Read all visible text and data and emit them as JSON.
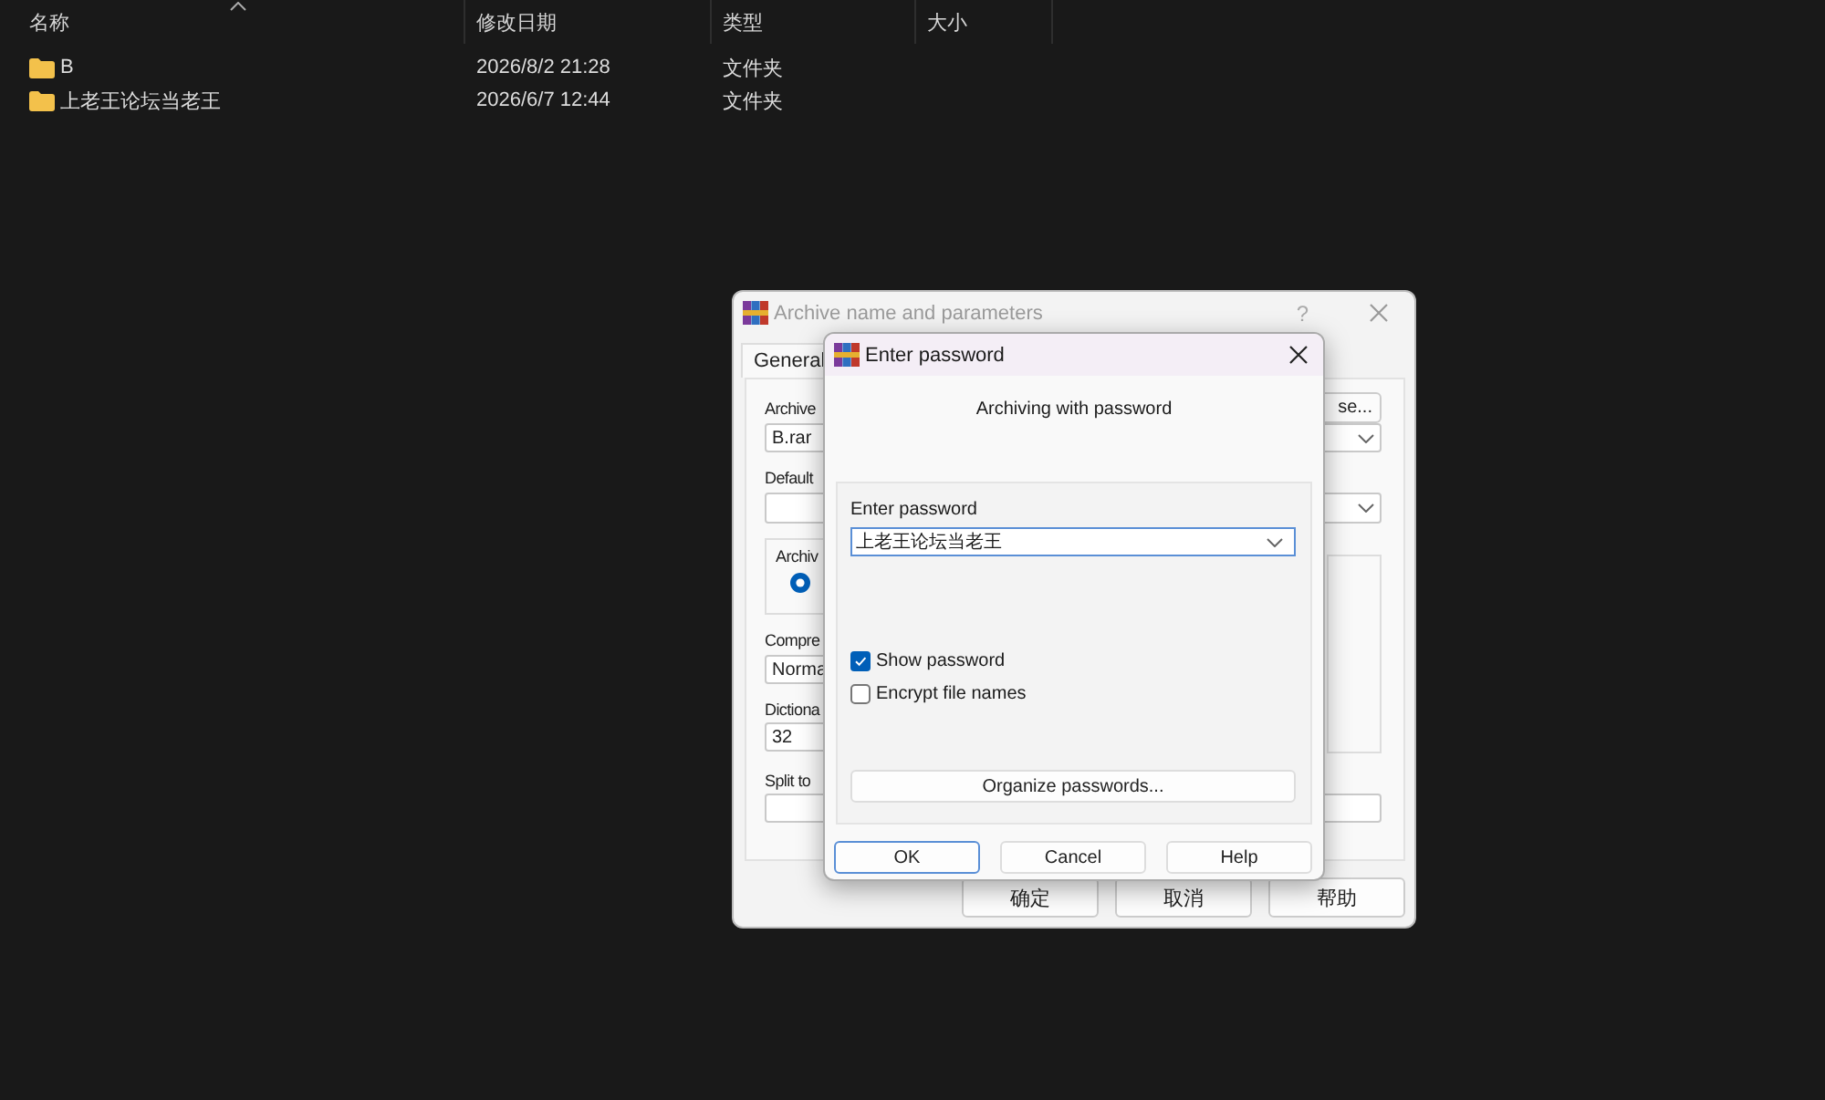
{
  "explorer": {
    "columns": [
      {
        "label": "名称",
        "sorted": true
      },
      {
        "label": "修改日期",
        "sorted": false
      },
      {
        "label": "类型",
        "sorted": false
      },
      {
        "label": "大小",
        "sorted": false
      }
    ],
    "rows": [
      {
        "name": "B",
        "modified": "2026/8/2 21:28",
        "type": "文件夹"
      },
      {
        "name": "上老王论坛当老王",
        "modified": "2026/6/7 12:44",
        "type": "文件夹"
      }
    ]
  },
  "archive_dialog": {
    "title": "Archive name and parameters",
    "help": "?",
    "tabs": [
      {
        "label": "General",
        "selected": true
      }
    ],
    "archive_name": {
      "label": "Archive",
      "value": "B.rar"
    },
    "browse_button": "se...",
    "default_profile": {
      "label": "Default"
    },
    "archive_format": {
      "label": "Archiv",
      "selected": true
    },
    "compression": {
      "label": "Compre",
      "value": "Norma"
    },
    "dictionary": {
      "label": "Dictiona",
      "value": "32"
    },
    "split": {
      "label": "Split to"
    },
    "buttons": [
      "确定",
      "取消",
      "帮助"
    ]
  },
  "password_dialog": {
    "title": "Enter password",
    "heading": "Archiving with password",
    "password": {
      "label": "Enter password",
      "value": "上老王论坛当老王"
    },
    "options": [
      {
        "label": "Show password",
        "checked": true
      },
      {
        "label": "Encrypt file names",
        "checked": false
      }
    ],
    "organize_button": "Organize passwords...",
    "buttons": [
      {
        "label": "OK",
        "default": true
      },
      {
        "label": "Cancel",
        "default": false
      },
      {
        "label": "Help",
        "default": false
      }
    ]
  }
}
